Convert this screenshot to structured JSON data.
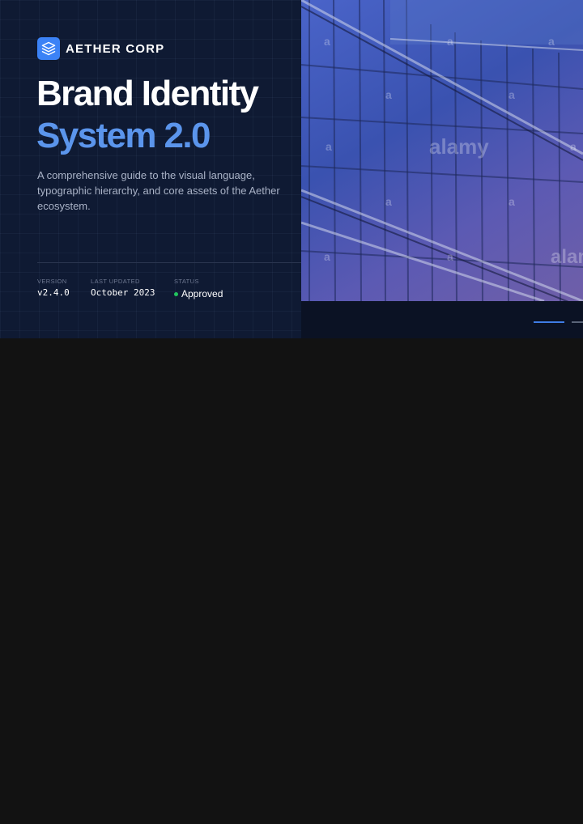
{
  "brand": {
    "name": "AETHER CORP",
    "logo_icon": "layers-icon",
    "logo_color": "#3b82f6"
  },
  "hero": {
    "title_line1": "Brand Identity",
    "title_line2": "System 2.0",
    "accent_color": "#5b95ec",
    "description": "A comprehensive guide to the visual language, typographic hierarchy, and core assets of the Aether ecosystem."
  },
  "meta": {
    "version_label": "VERSION",
    "version_value": "v2.4.0",
    "updated_label": "LAST UPDATED",
    "updated_value": "October 2023",
    "status_label": "STATUS",
    "status_value": "Approved",
    "status_color": "#22c55e"
  },
  "photo": {
    "watermark": "alamy",
    "description_icon": "building-glass-facade-image"
  }
}
